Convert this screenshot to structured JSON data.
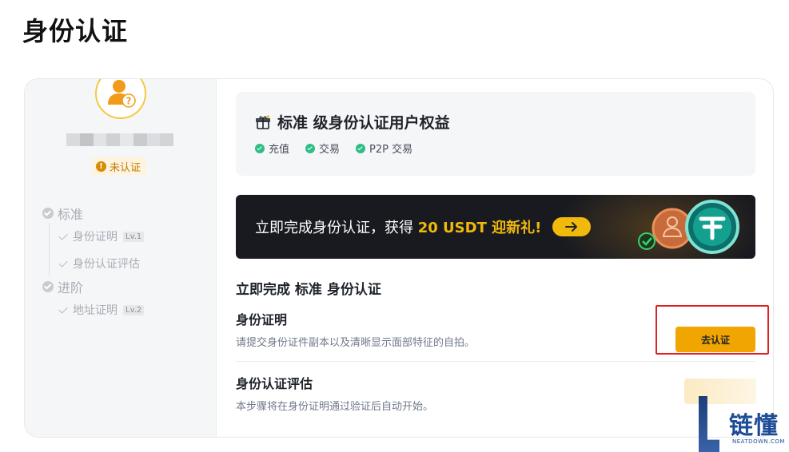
{
  "page": {
    "title": "身份认证"
  },
  "profile": {
    "status_badge": "未认证",
    "status_icon": "warning-icon"
  },
  "sidebar": {
    "levels": [
      {
        "label": "标准",
        "steps": [
          {
            "label": "身份证明",
            "badge": "Lv.1"
          },
          {
            "label": "身份认证评估",
            "badge": ""
          }
        ]
      },
      {
        "label": "进阶",
        "steps": [
          {
            "label": "地址证明",
            "badge": "Lv.2"
          }
        ]
      }
    ]
  },
  "benefits": {
    "title": "标准 级身份认证用户权益",
    "items": [
      "充值",
      "交易",
      "P2P 交易"
    ]
  },
  "promo": {
    "text_before": "立即完成身份认证，获得 ",
    "highlight": "20 USDT 迎新礼!",
    "arrow_icon": "arrow-right-icon"
  },
  "section": {
    "title": "立即完成 标准 身份认证"
  },
  "tasks": [
    {
      "name": "身份证明",
      "description": "请提交身份证件副本以及清晰显示面部特征的自拍。",
      "button_label": "去认证"
    },
    {
      "name": "身份认证评估",
      "description": "本步骤将在身份证明通过验证后自动开始。"
    }
  ],
  "watermark": {
    "name": "链懂",
    "url": "NEATDOWN.COM"
  },
  "colors": {
    "accent": "#f0b90b",
    "button": "#f0a500",
    "success": "#2ebd85",
    "highlight_box": "#e02020",
    "promo_bg": "#181a20"
  }
}
